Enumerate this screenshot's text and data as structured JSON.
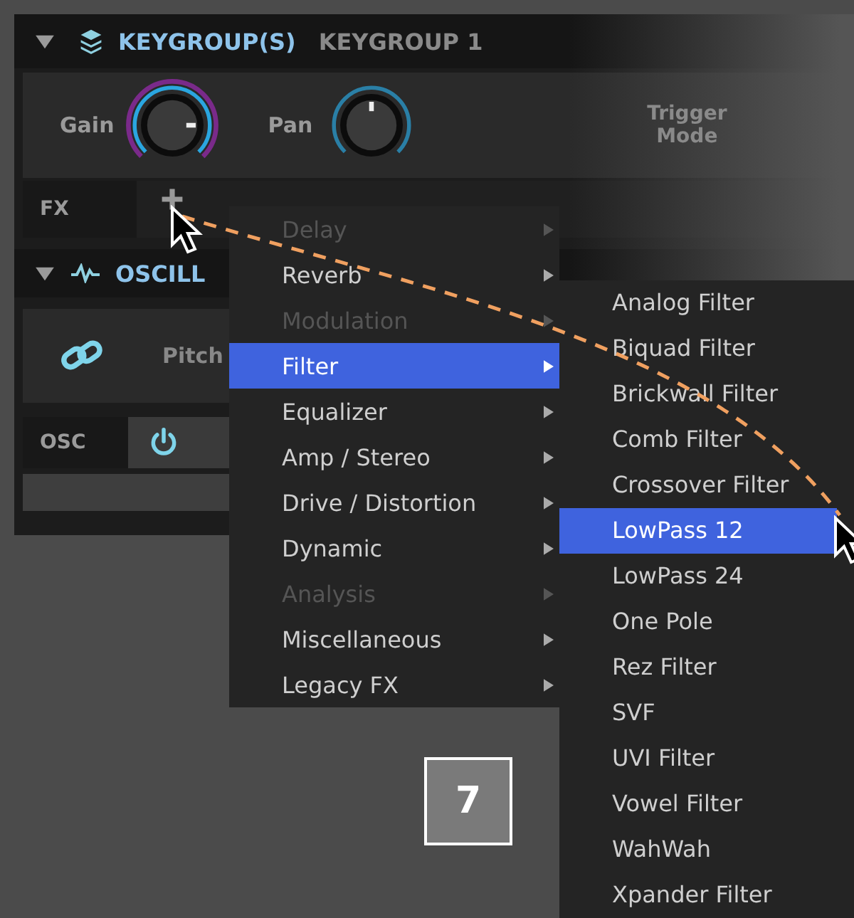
{
  "keygroup_panel": {
    "expanded": true,
    "title": "KEYGROUP(S)",
    "name": "KEYGROUP 1",
    "knobs": [
      {
        "label": "Gain",
        "modulated": true
      },
      {
        "label": "Pan",
        "modulated": false
      }
    ],
    "trigger_mode_label": "Trigger Mode",
    "fx_label": "FX"
  },
  "oscillator_panel": {
    "expanded": true,
    "title": "OSCILL",
    "pitch_label": "Pitch",
    "osc_label": "OSC",
    "power_on": true
  },
  "fx_menu": {
    "items": [
      {
        "label": "Delay",
        "disabled": true,
        "selected": false
      },
      {
        "label": "Reverb",
        "disabled": false,
        "selected": false
      },
      {
        "label": "Modulation",
        "disabled": true,
        "selected": false
      },
      {
        "label": "Filter",
        "disabled": false,
        "selected": true
      },
      {
        "label": "Equalizer",
        "disabled": false,
        "selected": false
      },
      {
        "label": "Amp / Stereo",
        "disabled": false,
        "selected": false
      },
      {
        "label": "Drive / Distortion",
        "disabled": false,
        "selected": false
      },
      {
        "label": "Dynamic",
        "disabled": false,
        "selected": false
      },
      {
        "label": "Analysis",
        "disabled": true,
        "selected": false
      },
      {
        "label": "Miscellaneous",
        "disabled": false,
        "selected": false
      },
      {
        "label": "Legacy FX",
        "disabled": false,
        "selected": false
      }
    ]
  },
  "filter_submenu": {
    "items": [
      {
        "label": "Analog Filter",
        "selected": false
      },
      {
        "label": "Biquad Filter",
        "selected": false
      },
      {
        "label": "Brickwall Filter",
        "selected": false
      },
      {
        "label": "Comb Filter",
        "selected": false
      },
      {
        "label": "Crossover Filter",
        "selected": false
      },
      {
        "label": "LowPass 12",
        "selected": true
      },
      {
        "label": "LowPass 24",
        "selected": false
      },
      {
        "label": "One Pole",
        "selected": false
      },
      {
        "label": "Rez Filter",
        "selected": false
      },
      {
        "label": "SVF",
        "selected": false
      },
      {
        "label": "UVI Filter",
        "selected": false
      },
      {
        "label": "Vowel Filter",
        "selected": false
      },
      {
        "label": "WahWah",
        "selected": false
      },
      {
        "label": "Xpander Filter",
        "selected": false
      }
    ]
  },
  "step_badge": "7"
}
